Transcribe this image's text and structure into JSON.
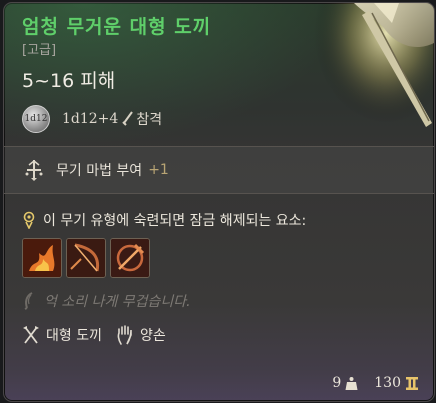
{
  "item": {
    "name": "엄청 무거운 대형 도끼",
    "rarity": "[고급]",
    "damage": "5~16 피해",
    "dice": "1d12+4",
    "dice_badge": "1d12",
    "damage_type": "참격"
  },
  "enchant": {
    "label": "무기 마법 부여",
    "bonus": "+1"
  },
  "proficiency": {
    "label": "이 무기 유형에 숙련되면 잠금 해제되는 요소:",
    "actions": [
      {
        "icon": "fire-strike-icon"
      },
      {
        "icon": "bow-slash-icon"
      },
      {
        "icon": "cleave-icon"
      }
    ]
  },
  "locked_text": "억 소리 나게 무겁습니다.",
  "properties": [
    {
      "icon": "crossed-axes-icon",
      "label": "대형 도끼"
    },
    {
      "icon": "hand-icon",
      "label": "양손"
    }
  ],
  "footer": {
    "weight": "9",
    "price": "130"
  },
  "colors": {
    "title": "#5fcf6a",
    "enchant_bonus": "#b9a574",
    "muted_text": "#7e7a75"
  }
}
